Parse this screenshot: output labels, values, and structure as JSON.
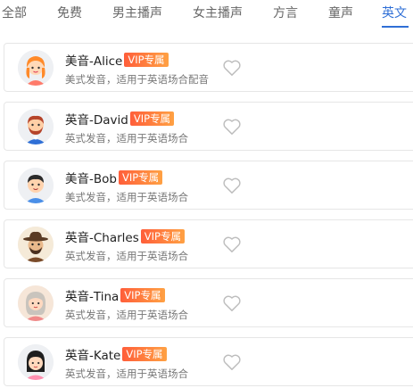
{
  "tabs": [
    {
      "label": "全部"
    },
    {
      "label": "免费"
    },
    {
      "label": "男主播声"
    },
    {
      "label": "女主播声"
    },
    {
      "label": "方言"
    },
    {
      "label": "童声"
    },
    {
      "label": "英文"
    }
  ],
  "active_tab": "英文",
  "voices": [
    {
      "name": "美音-Alice",
      "badge": "VIP专属",
      "desc": "美式发音，适用于英语场合配音",
      "avatar_icon": "girl-orange-hair-avatar"
    },
    {
      "name": "英音-David",
      "badge": "VIP专属",
      "desc": "英式发音，适用于英语场合",
      "avatar_icon": "man-beard-avatar"
    },
    {
      "name": "美音-Bob",
      "badge": "VIP专属",
      "desc": "美式发音，适用于英语场合",
      "avatar_icon": "boy-avatar"
    },
    {
      "name": "英音-Charles",
      "badge": "VIP专属",
      "desc": "英式发音，适用于英语场合",
      "avatar_icon": "cowboy-avatar"
    },
    {
      "name": "英音-Tina",
      "badge": "VIP专属",
      "desc": "英式发音，适用于英语场合",
      "avatar_icon": "older-woman-avatar"
    },
    {
      "name": "英音-Kate",
      "badge": "VIP专属",
      "desc": "英式发音，适用于英语场合",
      "avatar_icon": "girl-black-hair-avatar"
    }
  ],
  "colors": {
    "accent": "#2f6fd6",
    "vip_start": "#ff5e3a",
    "vip_end": "#ffa143"
  }
}
